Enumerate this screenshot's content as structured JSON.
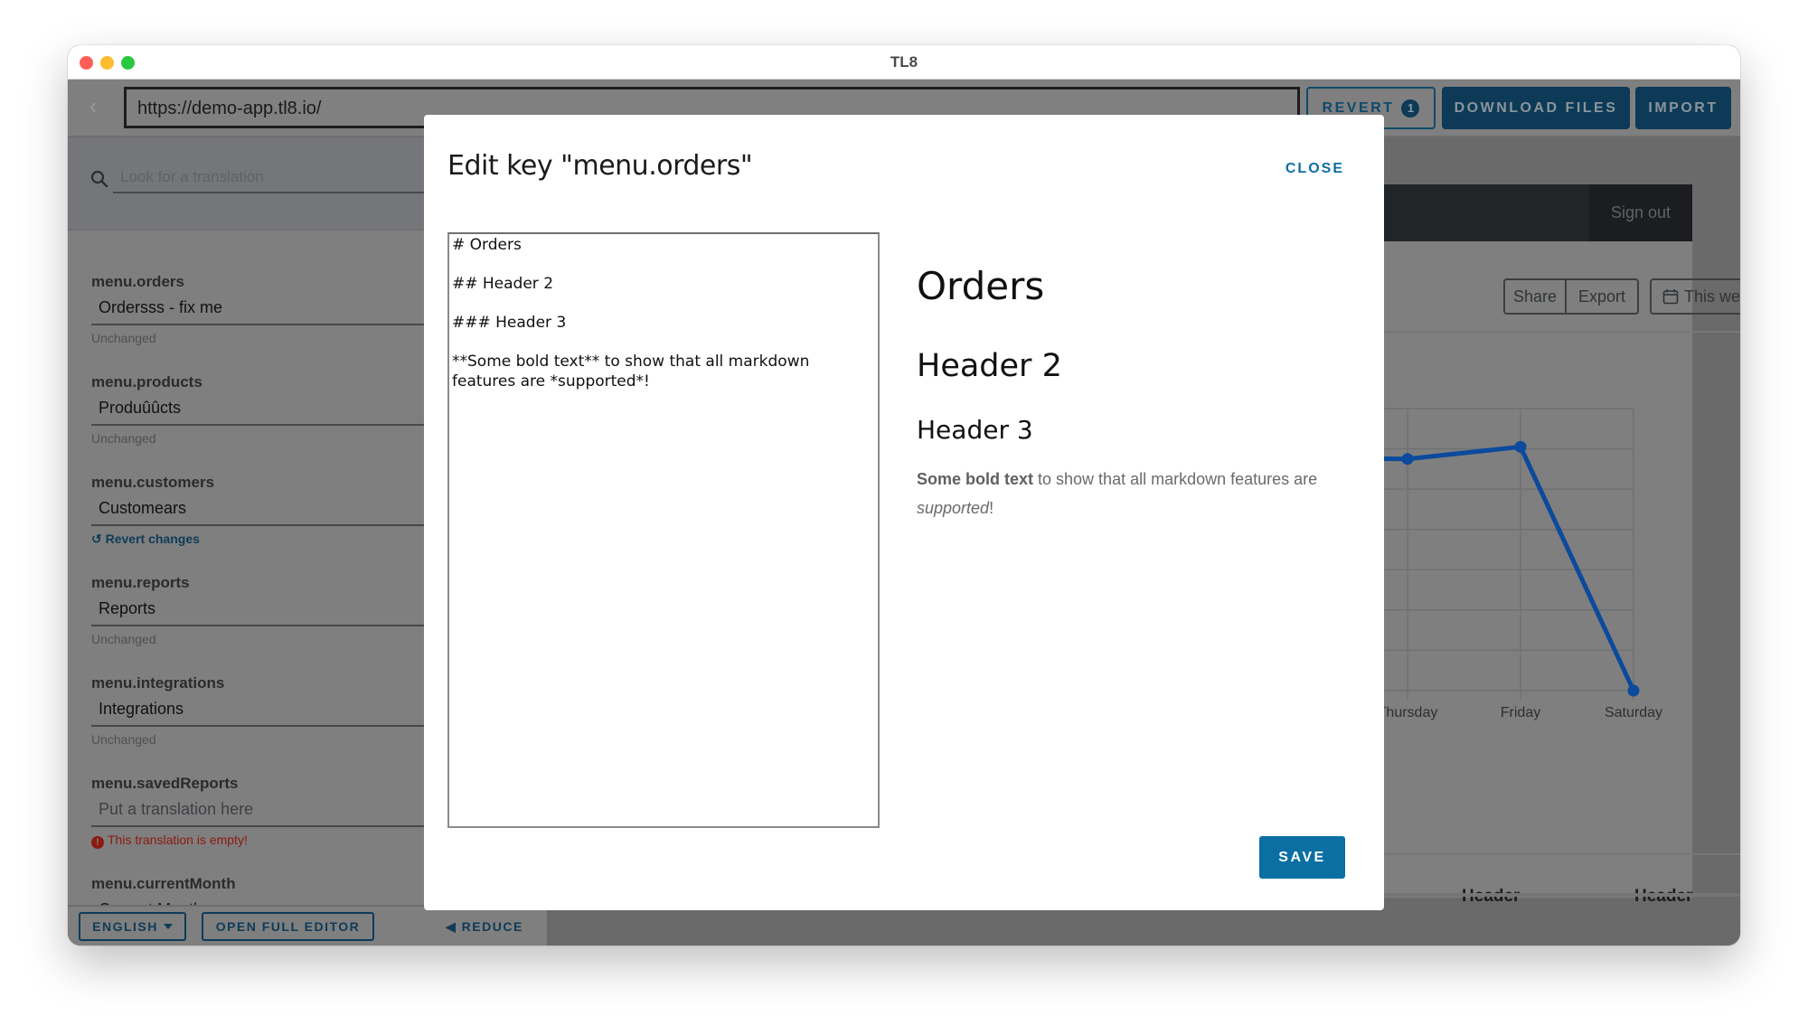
{
  "window": {
    "title": "TL8"
  },
  "toolbar": {
    "url": "https://demo-app.tl8.io/",
    "revert_label": "REVERT",
    "revert_count": "1",
    "download_label": "DOWNLOAD FILES",
    "import_label": "IMPORT"
  },
  "sidebar": {
    "search_placeholder": "Look for a translation",
    "entries": [
      {
        "key": "menu.orders",
        "value": "Ordersss - fix me",
        "status": "Unchanged",
        "status_type": "unchanged"
      },
      {
        "key": "menu.products",
        "value": "Produûûcts",
        "status": "Unchanged",
        "status_type": "unchanged"
      },
      {
        "key": "menu.customers",
        "value": "Customears",
        "status": "Revert changes",
        "status_type": "revert"
      },
      {
        "key": "menu.reports",
        "value": "Reports",
        "status": "Unchanged",
        "status_type": "unchanged"
      },
      {
        "key": "menu.integrations",
        "value": "Integrations",
        "status": "Unchanged",
        "status_type": "unchanged"
      },
      {
        "key": "menu.savedReports",
        "value": "",
        "placeholder": "Put a translation here",
        "status": "This translation is empty!",
        "status_type": "error"
      },
      {
        "key": "menu.currentMonth",
        "value": "Current Month",
        "status": "",
        "status_type": ""
      }
    ],
    "language_label": "ENGLISH",
    "full_editor_label": "OPEN FULL EDITOR",
    "reduce_label": "REDUCE"
  },
  "app": {
    "signout_label": "Sign out",
    "share_label": "Share",
    "export_label": "Export",
    "period_label": "This week",
    "table_headers": [
      "Header",
      "Header"
    ]
  },
  "chart_data": {
    "type": "line",
    "title": "",
    "xlabel": "",
    "ylabel": "",
    "categories": [
      "Thursday",
      "Friday",
      "Saturday"
    ],
    "series": [
      {
        "name": "",
        "color": "#0b4a9c",
        "values": [
          5.75,
          6.05,
          0
        ]
      }
    ],
    "ylim": [
      0,
      7
    ],
    "y_unit": "gridline steps (y-axis labels hidden behind modal)",
    "grid": true,
    "note": "Earlier days (left of Thursday) are hidden behind the modal"
  },
  "modal": {
    "title": "Edit key \"menu.orders\"",
    "close_label": "CLOSE",
    "markdown_source": "# Orders\n\n## Header 2\n\n### Header 3\n\n**Some bold text** to show that all markdown features are *supported*!",
    "preview": {
      "h1": "Orders",
      "h2": "Header 2",
      "h3": "Header 3",
      "bold": "Some bold text",
      "text_mid": " to show that all markdown features are ",
      "italic": "supported",
      "text_end": "!"
    },
    "save_label": "SAVE"
  },
  "colors": {
    "accent": "#0b6fa4",
    "dark_accent": "#0c3a57",
    "error": "#8c1a10",
    "chart_line": "#0b4a9c"
  }
}
